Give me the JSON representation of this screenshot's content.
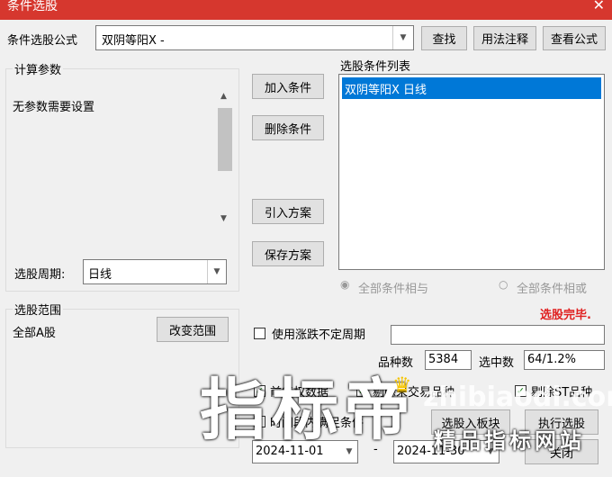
{
  "window": {
    "title": "条件选股",
    "close": "✕"
  },
  "formula": {
    "label": "条件选股公式",
    "value": "双阴等阳X  -"
  },
  "buttons": {
    "find": "查找",
    "usage": "用法注释",
    "view_formula": "查看公式",
    "add_cond": "加入条件",
    "del_cond": "删除条件",
    "import_plan": "引入方案",
    "save_plan": "保存方案",
    "change_range": "改变范围",
    "to_block": "选股入板块",
    "execute": "执行选股",
    "close": "关闭"
  },
  "params": {
    "legend": "计算参数",
    "text": "无参数需要设置",
    "period_label": "选股周期:",
    "period_value": "日线"
  },
  "conditions": {
    "legend": "选股条件列表",
    "items": [
      "双阴等阳X  日线"
    ]
  },
  "logic": {
    "and": "全部条件相与",
    "or": "全部条件相或"
  },
  "status": {
    "done": "选股完毕.",
    "done_color": "#e02020"
  },
  "range": {
    "legend": "选股范围",
    "value": "全部A股"
  },
  "options": {
    "uncertain_period": "使用涨跌不定周期",
    "pre_data": "前复权数据",
    "st_remove": "剔除ST品种",
    "time_period": "时间段内满足条件",
    "suspended": "剔除未交易品种"
  },
  "stats": {
    "count_label": "品种数",
    "count": "5384",
    "selected_label": "选中数",
    "selected": "64/1.2%"
  },
  "dates": {
    "start": "2024-11-01",
    "end": "2024-11-30",
    "sep": "-"
  },
  "watermark": {
    "big": "指标帝",
    "url": "zhibiaodi.com",
    "sub": "精品指标网站"
  }
}
